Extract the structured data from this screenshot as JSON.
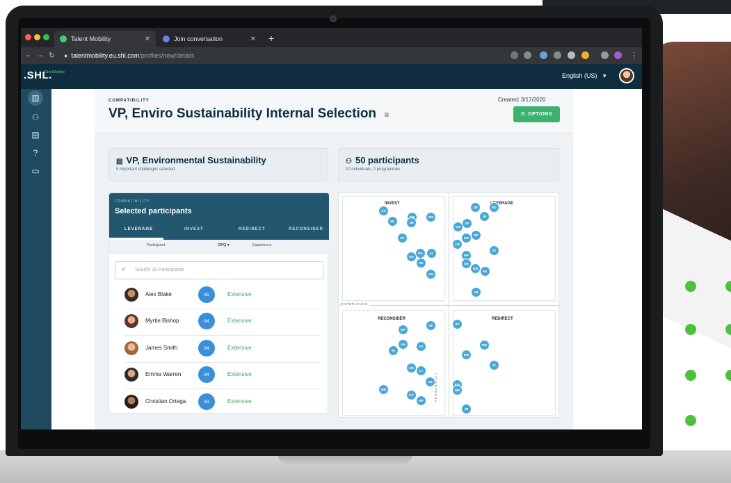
{
  "browser": {
    "tabs": [
      {
        "label": "Talent Mobility"
      },
      {
        "label": "Join conversation"
      }
    ],
    "url_host": "talentmobility.eu.shl.com",
    "url_path": "/profiles/new/details"
  },
  "app": {
    "logo": ".SHL.",
    "logo_sub": "TalentMobility",
    "language": "English (US)",
    "language_caret": "▾"
  },
  "header": {
    "overline": "COMPATIBILITY",
    "title": "VP, Enviro Sustainability Internal Selection",
    "title_icon": "≡",
    "created": "Created: 3/17/2020",
    "options_label": "OPTIONS",
    "options_icon": "≡"
  },
  "role_card": {
    "title": "VP, Environmental Sustainability",
    "subtitle": "5 important challenges selected"
  },
  "participants_card": {
    "title": "50 participants",
    "subtitle": "10 individuals, 0 programmes"
  },
  "selected_panel": {
    "overline": "COMPATIBILITY",
    "title": "Selected participants",
    "tabs": [
      "LEVERAGE",
      "INVEST",
      "REDIRECT",
      "RECONSIDER"
    ],
    "columns": [
      "Participant",
      "OPQ ▾",
      "Experience"
    ],
    "search_placeholder": "Search 19 Participants",
    "rows": [
      {
        "name": "Alex Blake",
        "score": "85",
        "experience": "Extensive"
      },
      {
        "name": "Myrtie Bishop",
        "score": "84",
        "experience": "Extensive"
      },
      {
        "name": "James Smith",
        "score": "84",
        "experience": "Extensive"
      },
      {
        "name": "Emma Warren",
        "score": "84",
        "experience": "Extensive"
      },
      {
        "name": "Christian Ortega",
        "score": "83",
        "experience": "Extensive"
      }
    ]
  },
  "quadrants": {
    "labels": [
      "INVEST",
      "LEVERAGE",
      "RECONSIDER",
      "REDIRECT"
    ],
    "axis_experience": "EXPERIENCE",
    "axis_personality": "PERSONALITY",
    "bubbles": [
      "AH",
      "DW",
      "WS",
      "ML",
      "JM",
      "RE",
      "DG",
      "AL",
      "EH",
      "AE",
      "AM",
      "JM",
      "RS",
      "JR",
      "SW",
      "SP",
      "WS",
      "RP",
      "LM",
      "IB",
      "MP",
      "EH",
      "NM",
      "EK",
      "VB",
      "MP",
      "DF",
      "AH",
      "YK",
      "IB",
      "AW",
      "LF",
      "JM",
      "MB",
      "DC",
      "MP",
      "RF",
      "MR",
      "WG",
      "IS",
      "KW",
      "MM",
      "JB"
    ]
  },
  "colors": {
    "accent": "#3db170",
    "nav": "#0f2d3f",
    "sidebar": "#1f4a5f",
    "bubble": "#4aa7d6",
    "score": "#3a8fd8"
  }
}
